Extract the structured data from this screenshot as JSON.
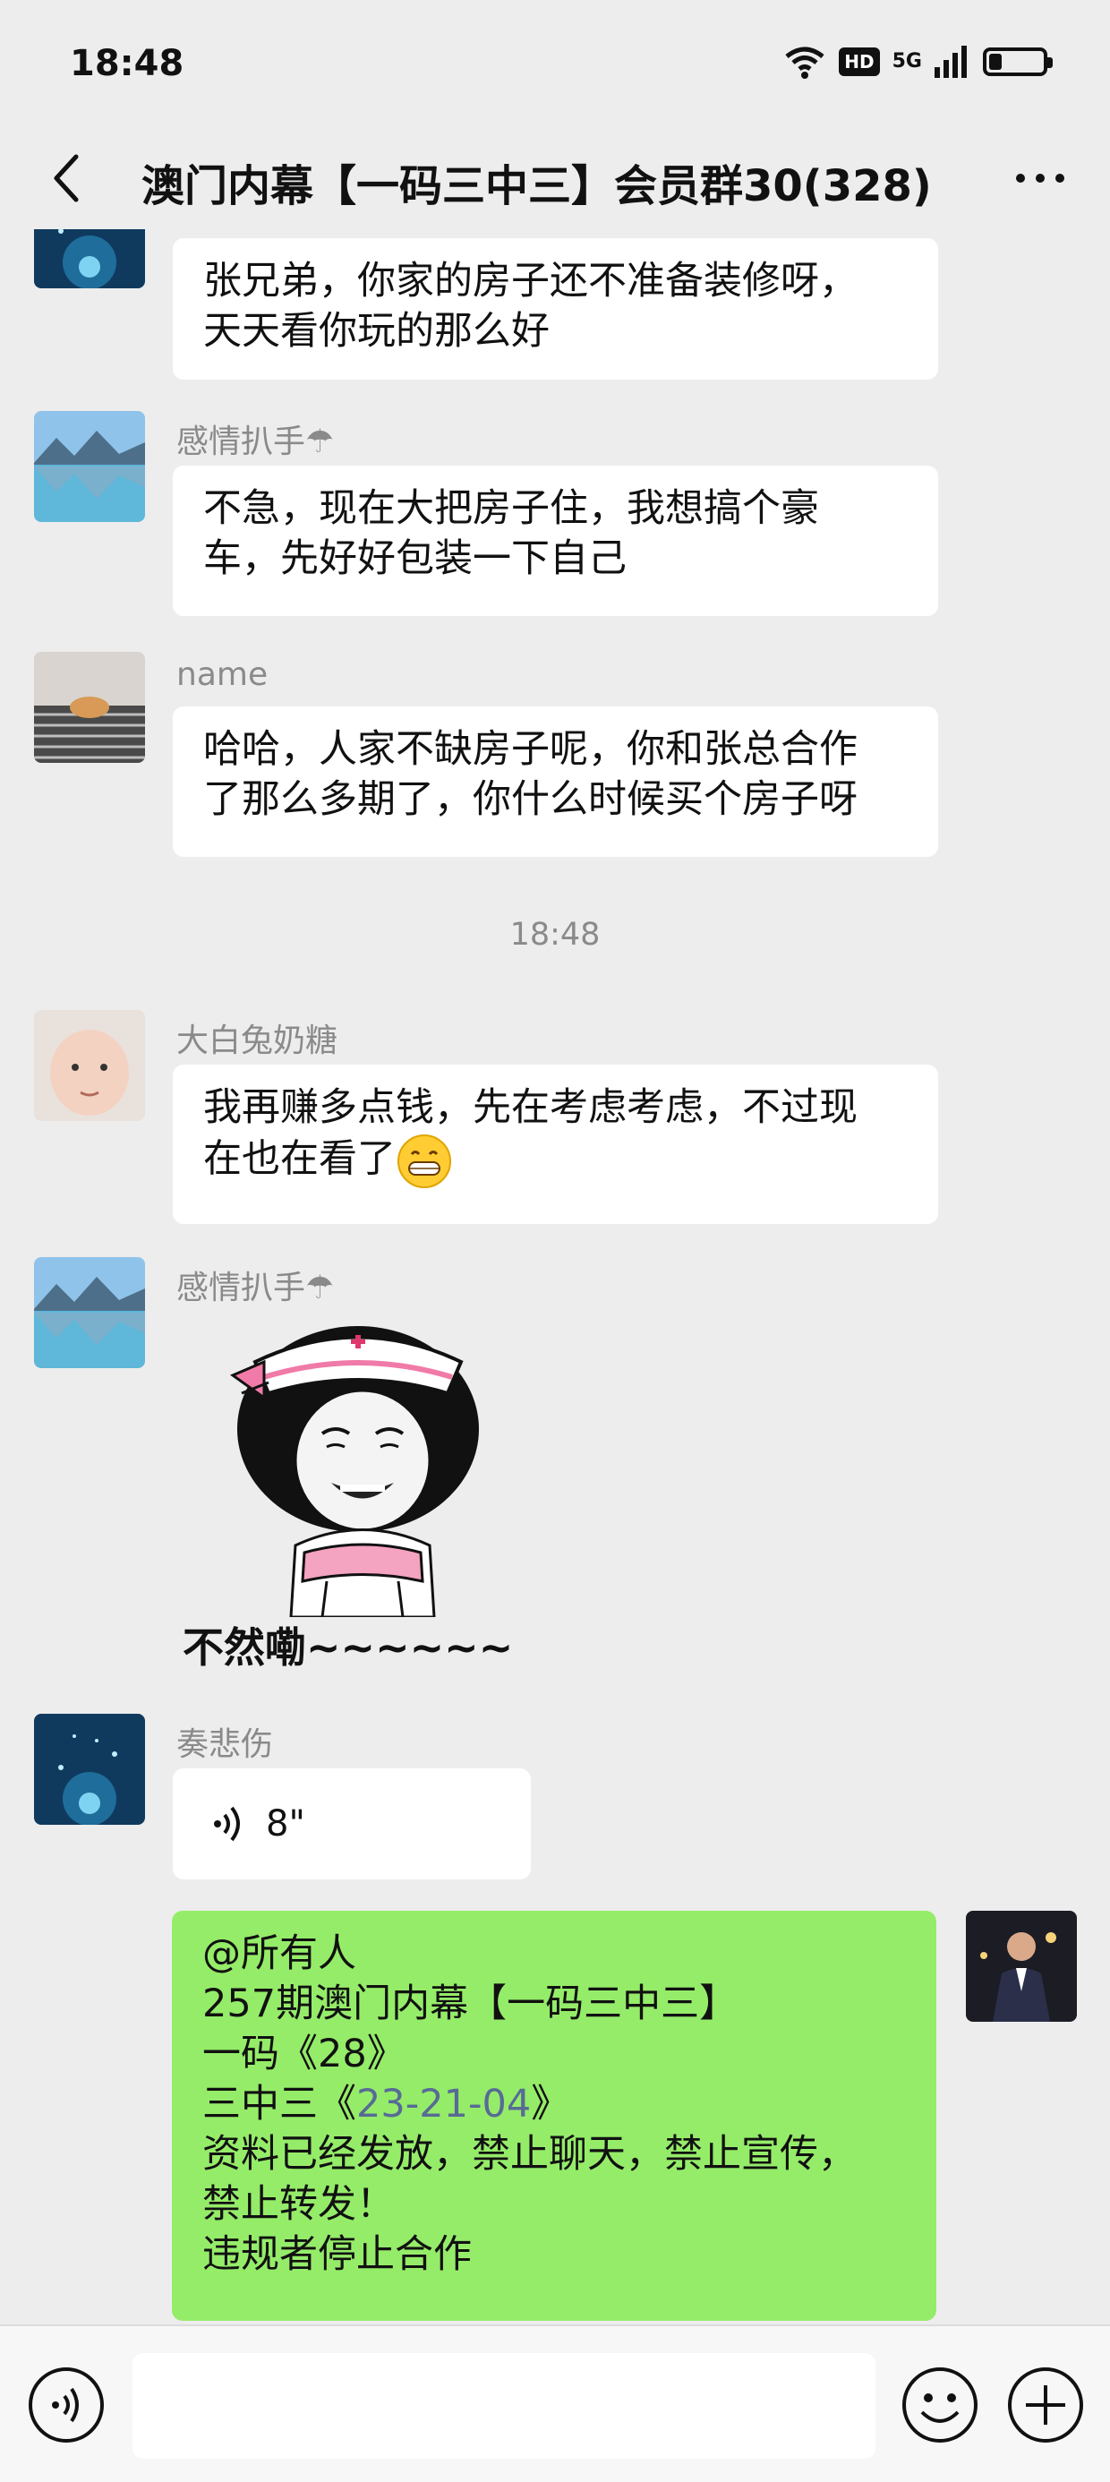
{
  "status_bar": {
    "time": "18:48",
    "hd": "HD",
    "network": "5G",
    "battery_level": 0.22
  },
  "header": {
    "title": "澳门内幕【一码三中三】会员群30(328)"
  },
  "messages": [
    {
      "sender": "",
      "lines": [
        "张兄弟，你家的房子还不准备装修呀，",
        "天天看你玩的那么好"
      ]
    },
    {
      "sender": "感情扒手☂",
      "lines": [
        "不急，现在大把房子住，我想搞个豪",
        "车，先好好包装一下自己"
      ]
    },
    {
      "sender": "name",
      "lines": [
        "哈哈，人家不缺房子呢，你和张总合作",
        "了那么多期了，你什么时候买个房子呀"
      ]
    },
    {
      "sender": "大白兔奶糖",
      "lines": [
        "我再赚多点钱，先在考虑考虑，不过现",
        "在也在看了"
      ]
    },
    {
      "sender": "感情扒手☂",
      "sticker_caption": "不然嘞~~~~~~"
    },
    {
      "sender": "奏悲伤",
      "voice_duration": "8\""
    },
    {
      "sender": "me",
      "lines": [
        "@所有人",
        "257期澳门内幕【一码三中三】",
        "一码《28》",
        "三中三《",
        "23-21-04",
        "》",
        "资料已经发放，禁止聊天，禁止宣传，",
        "禁止转发！",
        "违规者停止合作"
      ]
    }
  ],
  "timestamp": "18:48",
  "colors": {
    "background": "#ededed",
    "bubble_other": "#ffffff",
    "bubble_self": "#95ec69",
    "link": "#576b95"
  }
}
